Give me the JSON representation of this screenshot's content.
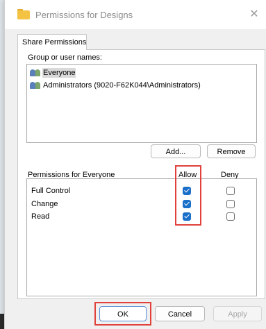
{
  "window": {
    "title": "Permissions for Designs",
    "close_glyph": "✕"
  },
  "tabs": [
    {
      "label": "Share Permissions"
    }
  ],
  "group_section": {
    "label": "Group or user names:",
    "users": [
      {
        "name": "Everyone",
        "selected": true
      },
      {
        "name": "Administrators (9020-F62K044\\Administrators)",
        "selected": false
      }
    ],
    "add_label": "Add...",
    "remove_label": "Remove"
  },
  "permissions_section": {
    "label": "Permissions for Everyone",
    "allow_header": "Allow",
    "deny_header": "Deny",
    "rows": [
      {
        "name": "Full Control",
        "allow": true,
        "deny": false
      },
      {
        "name": "Change",
        "allow": true,
        "deny": false
      },
      {
        "name": "Read",
        "allow": true,
        "deny": false
      }
    ]
  },
  "footer": {
    "ok_label": "OK",
    "cancel_label": "Cancel",
    "apply_label": "Apply"
  },
  "colors": {
    "highlight": "#e0413b",
    "checkbox_checked": "#1a6fc9",
    "folder_icon": "#f5c344"
  },
  "icons": {
    "title": "folder-icon",
    "user": "users-group-icon",
    "close": "close-icon",
    "check": "checkmark-icon"
  }
}
